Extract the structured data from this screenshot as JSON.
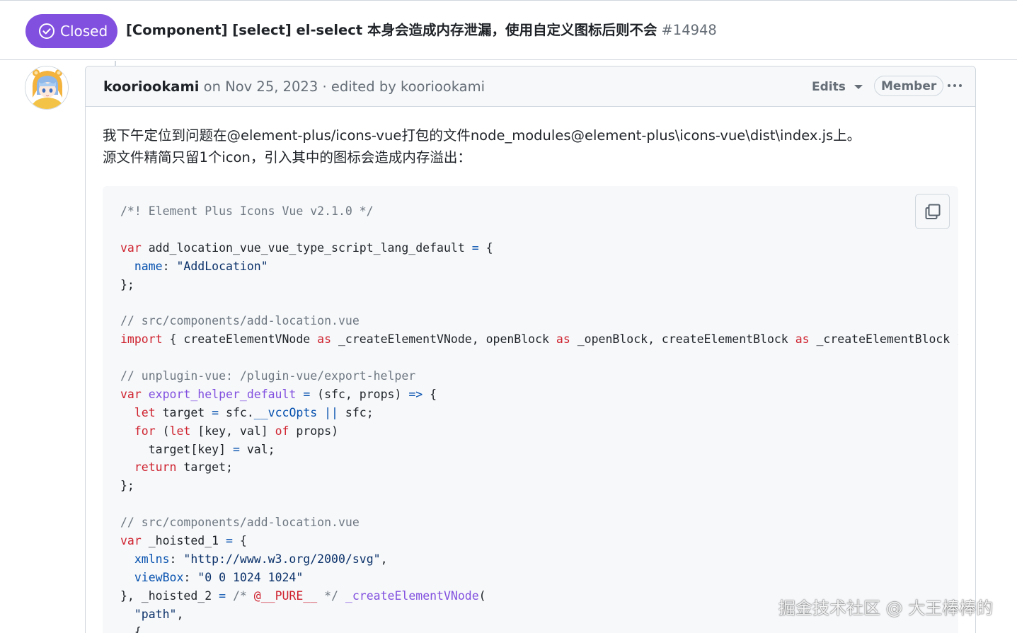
{
  "header": {
    "state_label": "Closed",
    "title": "[Component] [select] el-select 本身会造成内存泄漏，使用自定义图标后则不会",
    "number": "#14948",
    "state_color": "#8250df"
  },
  "comment": {
    "author": "kooriookami",
    "meta_text": " on Nov 25, 2023 · edited by kooriookami",
    "edits_label": "Edits",
    "role_badge": "Member",
    "body": [
      "我下午定位到问题在@element-plus/icons-vue打包的文件node_modules@element-plus\\icons-vue\\dist\\index.js上。",
      "源文件精简只留1个icon，引入其中的图标会造成内存溢出："
    ]
  },
  "code": {
    "lines": [
      [
        [
          "c",
          "/*! Element Plus Icons Vue v2.1.0 */"
        ]
      ],
      [],
      [
        [
          "k",
          "var"
        ],
        [
          "t",
          " add_location_vue_vue_type_script_lang_default "
        ],
        [
          "p",
          "="
        ],
        [
          "t",
          " {"
        ]
      ],
      [
        [
          "t",
          "  "
        ],
        [
          "p",
          "name"
        ],
        [
          "t",
          ": "
        ],
        [
          "s",
          "\"AddLocation\""
        ]
      ],
      [
        [
          "t",
          "};"
        ]
      ],
      [],
      [
        [
          "c",
          "// src/components/add-location.vue"
        ]
      ],
      [
        [
          "k",
          "import"
        ],
        [
          "t",
          " { createElementVNode "
        ],
        [
          "k",
          "as"
        ],
        [
          "t",
          " _createElementVNode, openBlock "
        ],
        [
          "k",
          "as"
        ],
        [
          "t",
          " _openBlock, createElementBlock "
        ],
        [
          "k",
          "as"
        ],
        [
          "t",
          " _createElementBlock }"
        ]
      ],
      [],
      [
        [
          "c",
          "// unplugin-vue: /plugin-vue/export-helper"
        ]
      ],
      [
        [
          "k",
          "var"
        ],
        [
          "t",
          " "
        ],
        [
          "f",
          "export_helper_default"
        ],
        [
          "t",
          " "
        ],
        [
          "p",
          "="
        ],
        [
          "t",
          " (sfc, props) "
        ],
        [
          "p",
          "=>"
        ],
        [
          "t",
          " {"
        ]
      ],
      [
        [
          "t",
          "  "
        ],
        [
          "k",
          "let"
        ],
        [
          "t",
          " target "
        ],
        [
          "p",
          "="
        ],
        [
          "t",
          " sfc."
        ],
        [
          "p",
          "__vccOpts"
        ],
        [
          "t",
          " "
        ],
        [
          "p",
          "||"
        ],
        [
          "t",
          " sfc;"
        ]
      ],
      [
        [
          "t",
          "  "
        ],
        [
          "k",
          "for"
        ],
        [
          "t",
          " ("
        ],
        [
          "k",
          "let"
        ],
        [
          "t",
          " [key, val] "
        ],
        [
          "k",
          "of"
        ],
        [
          "t",
          " props)"
        ]
      ],
      [
        [
          "t",
          "    target[key] "
        ],
        [
          "p",
          "="
        ],
        [
          "t",
          " val;"
        ]
      ],
      [
        [
          "t",
          "  "
        ],
        [
          "k",
          "return"
        ],
        [
          "t",
          " target;"
        ]
      ],
      [
        [
          "t",
          "};"
        ]
      ],
      [],
      [
        [
          "c",
          "// src/components/add-location.vue"
        ]
      ],
      [
        [
          "k",
          "var"
        ],
        [
          "t",
          " _hoisted_1 "
        ],
        [
          "p",
          "="
        ],
        [
          "t",
          " {"
        ]
      ],
      [
        [
          "t",
          "  "
        ],
        [
          "p",
          "xmlns"
        ],
        [
          "t",
          ": "
        ],
        [
          "s",
          "\"http://www.w3.org/2000/svg\""
        ],
        [
          "t",
          ","
        ]
      ],
      [
        [
          "t",
          "  "
        ],
        [
          "p",
          "viewBox"
        ],
        [
          "t",
          ": "
        ],
        [
          "s",
          "\"0 0 1024 1024\""
        ]
      ],
      [
        [
          "t",
          "}, _hoisted_2 "
        ],
        [
          "p",
          "="
        ],
        [
          "t",
          " "
        ],
        [
          "c",
          "/* "
        ],
        [
          "k",
          "@__PURE__"
        ],
        [
          "c",
          " */"
        ],
        [
          "t",
          " "
        ],
        [
          "f",
          "_createElementVNode"
        ],
        [
          "t",
          "("
        ]
      ],
      [
        [
          "t",
          "  "
        ],
        [
          "s",
          "\"path\""
        ],
        [
          "t",
          ","
        ]
      ],
      [
        [
          "t",
          "  {"
        ]
      ]
    ]
  },
  "icons": {
    "state": "check-circle-icon",
    "copy": "copy-icon",
    "caret": "triangle-down-icon",
    "more": "kebab-horizontal-icon"
  },
  "watermark": "掘金技术社区 @ 大王棒棒的"
}
